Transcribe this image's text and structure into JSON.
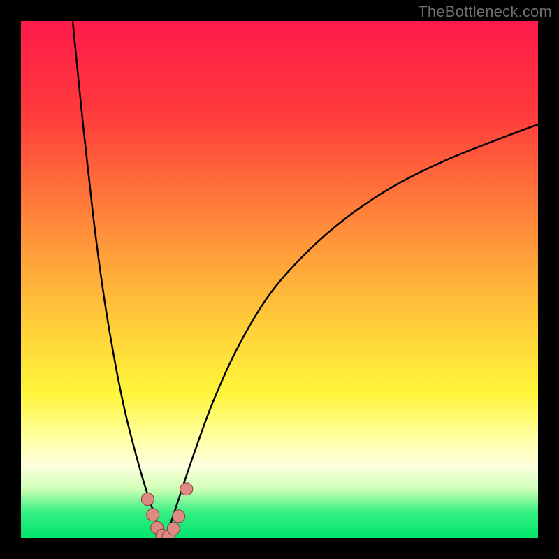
{
  "watermark": "TheBottleneck.com",
  "colors": {
    "frame": "#000000",
    "watermark_text": "#6f6f6f",
    "curve": "#000000",
    "dots_outline": "#8b3a3a",
    "dots_fill": "#dd8b82",
    "gradient_stops": [
      {
        "offset": 0.0,
        "color": "#ff1a4b"
      },
      {
        "offset": 0.18,
        "color": "#ff3b3b"
      },
      {
        "offset": 0.4,
        "color": "#ff8c3a"
      },
      {
        "offset": 0.6,
        "color": "#ffd23a"
      },
      {
        "offset": 0.72,
        "color": "#fff53a"
      },
      {
        "offset": 0.8,
        "color": "#ffff9a"
      },
      {
        "offset": 0.86,
        "color": "#ffffe0"
      },
      {
        "offset": 0.905,
        "color": "#ceffb5"
      },
      {
        "offset": 0.95,
        "color": "#37ef82"
      },
      {
        "offset": 1.0,
        "color": "#00e56c"
      }
    ]
  },
  "chart_data": {
    "type": "line",
    "title": "",
    "xlabel": "",
    "ylabel": "",
    "xlim": [
      0,
      100
    ],
    "ylim": [
      0,
      100
    ],
    "series": [
      {
        "name": "left-branch",
        "x": [
          10,
          12,
          14,
          16,
          18,
          20,
          22,
          24,
          26,
          27,
          28
        ],
        "y": [
          100,
          80,
          62,
          47,
          35,
          25,
          17,
          10,
          4,
          1,
          0
        ]
      },
      {
        "name": "right-branch",
        "x": [
          28,
          30,
          33,
          37,
          42,
          48,
          55,
          63,
          72,
          82,
          92,
          100
        ],
        "y": [
          0,
          6,
          15,
          26,
          37,
          47,
          55,
          62,
          68,
          73,
          77,
          80
        ]
      }
    ],
    "dots": {
      "name": "highlight-dots",
      "points": [
        {
          "x": 24.5,
          "y": 7.5
        },
        {
          "x": 25.5,
          "y": 4.5
        },
        {
          "x": 26.3,
          "y": 2.0
        },
        {
          "x": 27.3,
          "y": 0.5
        },
        {
          "x": 28.5,
          "y": 0.3
        },
        {
          "x": 29.5,
          "y": 1.8
        },
        {
          "x": 30.5,
          "y": 4.2
        },
        {
          "x": 32.0,
          "y": 9.5
        }
      ]
    }
  }
}
